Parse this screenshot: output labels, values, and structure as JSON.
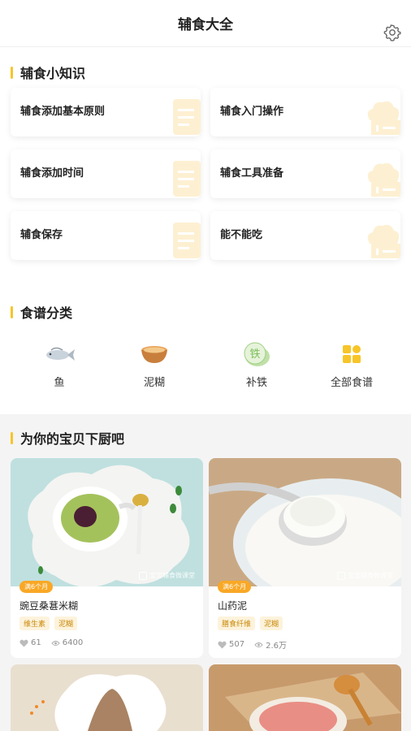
{
  "header": {
    "title": "辅食大全",
    "settings_icon": "gear-icon"
  },
  "knowledge": {
    "title": "辅食小知识",
    "items": [
      {
        "label": "辅食添加基本原则",
        "icon": "document-icon"
      },
      {
        "label": "辅食入门操作",
        "icon": "chef-hat-icon"
      },
      {
        "label": "辅食添加时间",
        "icon": "document-icon"
      },
      {
        "label": "辅食工具准备",
        "icon": "chef-hat-icon"
      },
      {
        "label": "辅食保存",
        "icon": "document-icon"
      },
      {
        "label": "能不能吃",
        "icon": "chef-hat-icon"
      }
    ]
  },
  "recipes": {
    "title": "食谱分类",
    "categories": [
      {
        "label": "鱼",
        "icon": "fish-icon"
      },
      {
        "label": "泥糊",
        "icon": "bowl-icon"
      },
      {
        "label": "补铁",
        "icon": "iron-icon",
        "glyph": "铁"
      },
      {
        "label": "全部食谱",
        "icon": "grid-icon"
      }
    ]
  },
  "cook": {
    "title": "为你的宝贝下厨吧",
    "cards": [
      {
        "age": "满6个月",
        "name": "豌豆桑葚米糊",
        "tags": [
          "维生素",
          "泥糊"
        ],
        "likes": "61",
        "views": "6400",
        "watermark": "宝宝辅食微课堂"
      },
      {
        "age": "满6个月",
        "name": "山药泥",
        "tags": [
          "膳食纤维",
          "泥糊"
        ],
        "likes": "507",
        "views": "2.6万",
        "watermark": "宝宝辅食微课堂"
      },
      {
        "age": "",
        "name": "",
        "tags": [],
        "likes": "",
        "views": ""
      },
      {
        "age": "",
        "name": "",
        "tags": [],
        "likes": "",
        "views": ""
      }
    ]
  },
  "colors": {
    "accent": "#f7c528",
    "tag_text": "#c98a0a",
    "tag_bg": "#fdf3dc",
    "badge": "#f9a825",
    "gray_bg": "#f4f4f4"
  }
}
